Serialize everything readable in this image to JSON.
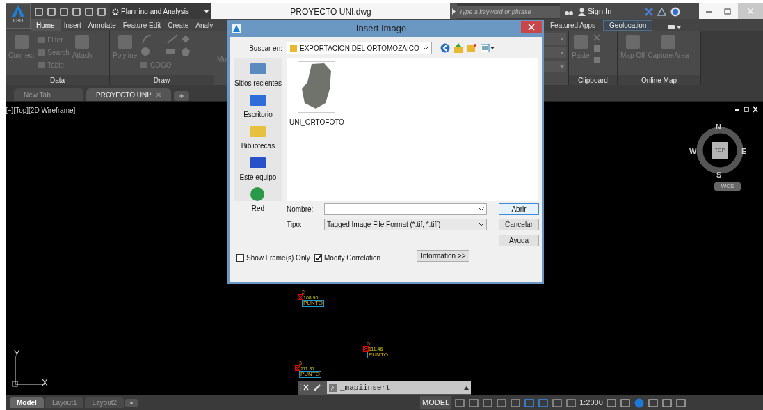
{
  "title_bar": {
    "app_badge": "C3D",
    "workspace": "Planning and Analysis",
    "file_title": "PROYECTO UNI.dwg",
    "search_placeholder": "Type a keyword or phrase",
    "sign_in": "Sign In"
  },
  "ribbon_tabs": [
    {
      "label": "Home",
      "selected": true,
      "kind": "normal"
    },
    {
      "label": "Insert",
      "selected": false,
      "kind": "normal"
    },
    {
      "label": "Annotate",
      "selected": false,
      "kind": "normal"
    },
    {
      "label": "Feature Edit",
      "selected": false,
      "kind": "normal"
    },
    {
      "label": "Create",
      "selected": false,
      "kind": "normal"
    },
    {
      "label": "Analy",
      "selected": false,
      "kind": "normal"
    },
    {
      "label": "Featured Apps",
      "selected": false,
      "kind": "normal"
    },
    {
      "label": "Geolocation",
      "selected": false,
      "kind": "contextual"
    }
  ],
  "ribbon_left": {
    "data_panel": {
      "connect": "Connect",
      "filter": "Filter",
      "search": "Search",
      "table": "Table",
      "attach": "Attach",
      "label": "Data"
    },
    "draw_panel": {
      "polyline": "Polyline",
      "cogo": "COGO",
      "label": "Draw"
    },
    "cut_panel": "Mo"
  },
  "ribbon_right": {
    "clipboard": {
      "paste": "Paste",
      "label": "Clipboard"
    },
    "online_map": {
      "map_off": "Map Off",
      "capture_area": "Capture Area",
      "label": "Online Map"
    }
  },
  "doc_tabs": [
    {
      "label": "New Tab",
      "selected": false
    },
    {
      "label": "PROYECTO UNI*",
      "selected": true
    }
  ],
  "viewport_label": "[−][Top][2D Wireframe]",
  "viewcube": {
    "north": "N",
    "south": "S",
    "east": "E",
    "west": "W",
    "face": "TOP",
    "ucs_menu": "WCS"
  },
  "points": [
    {
      "number": "2",
      "elevation": "108.90",
      "label": "PUNTO"
    },
    {
      "number": "5",
      "elevation": "111.46",
      "label": "PUNTO"
    },
    {
      "number": "3",
      "elevation": "111.37",
      "label": "PUNTO"
    }
  ],
  "ucs_icon": {
    "x": "X",
    "y": "Y"
  },
  "command_line": {
    "text": "_mapiinsert"
  },
  "layout_tabs": [
    {
      "label": "Model",
      "selected": true
    },
    {
      "label": "Layout1",
      "selected": false
    },
    {
      "label": "Layout2",
      "selected": false
    }
  ],
  "status_bar": {
    "space": "MODEL",
    "scale": "1:2000"
  },
  "dialog": {
    "title": "Insert Image",
    "look_in_label": "Buscar en:",
    "look_in": "EXPORTACION DEL ORTOMOZAICO",
    "places": [
      {
        "label": "Sitios recientes",
        "kind": "recent"
      },
      {
        "label": "Escritorio",
        "kind": "desktop"
      },
      {
        "label": "Bibliotecas",
        "kind": "libraries"
      },
      {
        "label": "Este equipo",
        "kind": "computer"
      },
      {
        "label": "Red",
        "kind": "network"
      }
    ],
    "files": [
      {
        "name": "UNI_ORTOFOTO"
      }
    ],
    "name_label": "Nombre:",
    "type_label": "Tipo:",
    "type": "Tagged Image File Format (*.tif, *.tiff)",
    "buttons": [
      {
        "label": "Abrir",
        "default": true
      },
      {
        "label": "Cancelar",
        "default": false
      },
      {
        "label": "Ayuda",
        "default": false
      }
    ],
    "options": [
      {
        "label": "Show Frame(s) Only",
        "checked": false
      },
      {
        "label": "Modify Correlation",
        "checked": true
      }
    ],
    "info_button": "Information >>"
  }
}
